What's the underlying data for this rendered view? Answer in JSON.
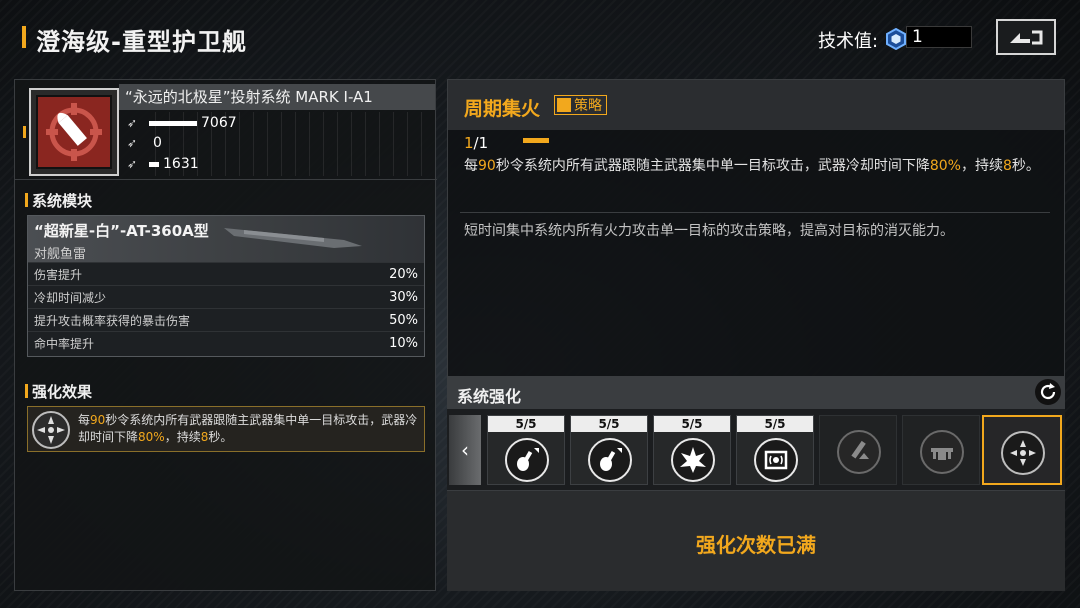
{
  "header": {
    "title": "澄海级-重型护卫舰",
    "tech_label": "技术值:",
    "tech_value": "1",
    "back_icon": "back-arrow-icon"
  },
  "weapon": {
    "name": "“永远的北极星”投射系统 MARK I-A1",
    "icon": "bullet-target-icon",
    "stats": [
      {
        "icon": "damage-arrow-icon",
        "value": "7067",
        "fill": 0.85
      },
      {
        "icon": "speed-arrow-icon",
        "value": "0",
        "fill": 0
      },
      {
        "icon": "range-arrow-icon",
        "value": "1631",
        "fill": 0.2
      }
    ]
  },
  "system_module": {
    "section_title": "系统模块",
    "name": "“超新星-白”-AT-360A型",
    "type": "对舰鱼雷",
    "rows": [
      {
        "label": "伤害提升",
        "value": "20%"
      },
      {
        "label": "冷却时间减少",
        "value": "30%"
      },
      {
        "label": "提升攻击概率获得的暴击伤害",
        "value": "50%"
      },
      {
        "label": "命中率提升",
        "value": "10%"
      }
    ]
  },
  "enhance_effect": {
    "section_title": "强化效果",
    "icon": "focus-fire-icon",
    "text_1": "每",
    "num_1": "90",
    "text_2": "秒令系统内所有武器跟随主武器集中单一目标攻击，武器冷却时间下降",
    "num_2": "80%",
    "text_3": "，持续",
    "num_3": "8",
    "text_4": "秒。"
  },
  "skill": {
    "name": "周期集火",
    "tag": "策略",
    "level_current": "1",
    "level_total": "/1",
    "desc_1": "每",
    "num_1": "90",
    "desc_2": "秒令系统内所有武器跟随主武器集中单一目标攻击，武器冷却时间下降",
    "num_2": "80%",
    "desc_3": "，持续",
    "num_3": "8",
    "desc_4": "秒。",
    "sub_desc": "短时间集中系统内所有火力攻击单一目标的攻击策略，提高对目标的消灭能力。"
  },
  "system_enhance": {
    "title": "系统强化",
    "refresh_icon": "refresh-icon",
    "slots": [
      {
        "count": "5/5",
        "icon": "guitar-arrow-icon"
      },
      {
        "count": "5/5",
        "icon": "guitar-arrow-icon"
      },
      {
        "count": "5/5",
        "icon": "explosion-icon"
      },
      {
        "count": "5/5",
        "icon": "signal-chip-icon"
      },
      {
        "count": "",
        "icon": "pen-upgrade-icon"
      },
      {
        "count": "",
        "icon": "drone-icon"
      },
      {
        "count": "",
        "icon": "focus-fire-icon"
      }
    ],
    "maxed_text": "强化次数已满"
  },
  "colors": {
    "accent": "#f2a81d",
    "weapon_bg": "#8a2620"
  }
}
